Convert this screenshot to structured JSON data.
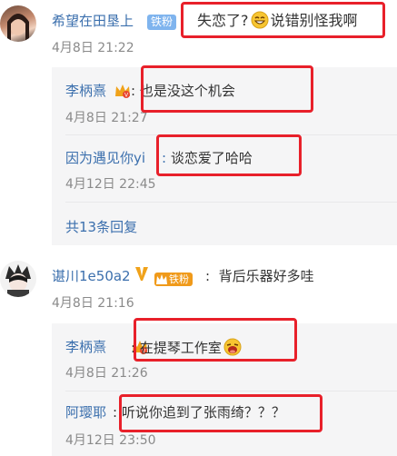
{
  "comments": [
    {
      "user": "希望在田垦上",
      "badge": "铁粉",
      "text_before": "失恋了?",
      "text_after": "说错别怪我啊",
      "time": "4月8日 21:22",
      "emoji": "grin-emoji",
      "replies": [
        {
          "user": "李柄熹",
          "text": "也是没这个机会",
          "time": "4月8日 21:27"
        },
        {
          "user": "因为遇见你yi",
          "text": "谈恋爱了哈哈",
          "time": "4月12日 22:45"
        }
      ],
      "more": "共13条回复"
    },
    {
      "user": "谌川1e50a2",
      "badge": "铁粉",
      "text": "背后乐器好多哇",
      "time": "4月8日 21:16",
      "replies": [
        {
          "user": "李柄熹",
          "text": "在提琴工作室",
          "time": "4月8日 21:26"
        },
        {
          "user": "阿璎耶",
          "text": "听说你追到了张雨绮？？？",
          "time": "4月12日 23:50"
        }
      ]
    }
  ],
  "colors": {
    "name": "#3b6fad",
    "highlight": "#e8202a",
    "reply_bg": "#f5f5f6",
    "badge": "#f09a1a"
  }
}
